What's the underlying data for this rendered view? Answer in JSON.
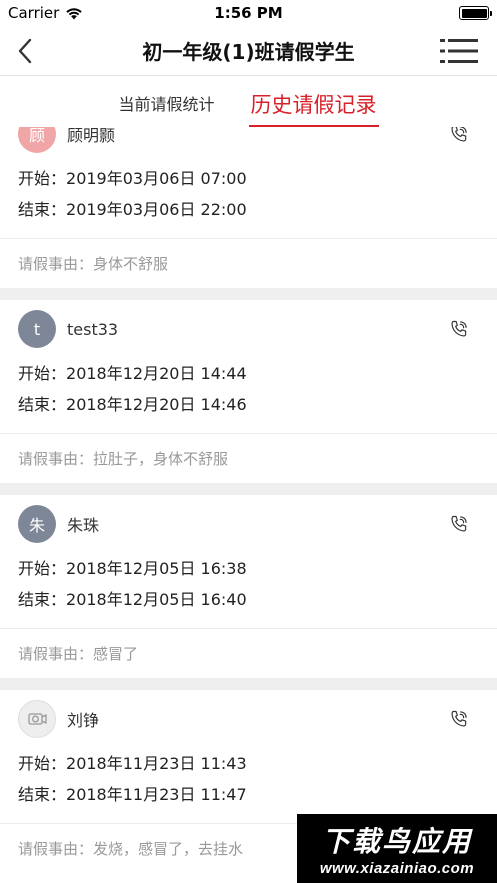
{
  "status_bar": {
    "carrier": "Carrier",
    "time": "1:56 PM"
  },
  "nav": {
    "title": "初一年级(1)班请假学生"
  },
  "tabs": [
    {
      "label": "当前请假统计",
      "active": false
    },
    {
      "label": "历史请假记录",
      "active": true
    }
  ],
  "labels": {
    "start": "开始：",
    "end": "结束：",
    "reason": "请假事由："
  },
  "records": [
    {
      "avatar_text": "顾",
      "name": "顾明颢",
      "start": "2019年03月06日 07:00",
      "end": "2019年03月06日 22:00",
      "reason": "身体不舒服"
    },
    {
      "avatar_text": "t",
      "name": "test33",
      "start": "2018年12月20日 14:44",
      "end": "2018年12月20日 14:46",
      "reason": "拉肚子，身体不舒服"
    },
    {
      "avatar_text": "朱",
      "name": "朱珠",
      "start": "2018年12月05日 16:38",
      "end": "2018年12月05日 16:40",
      "reason": "感冒了"
    },
    {
      "avatar_text": "",
      "name": "刘铮",
      "start": "2018年11月23日 11:43",
      "end": "2018年11月23日 11:47",
      "reason": "发烧，感冒了，去挂水"
    }
  ],
  "watermark": {
    "line1": "下载鸟应用",
    "line2": "www.xiazainiao.com"
  },
  "colors": {
    "accent": "#d8222b",
    "avatar_gray": "#7e8798",
    "avatar_pink": "#f0a6a6"
  }
}
